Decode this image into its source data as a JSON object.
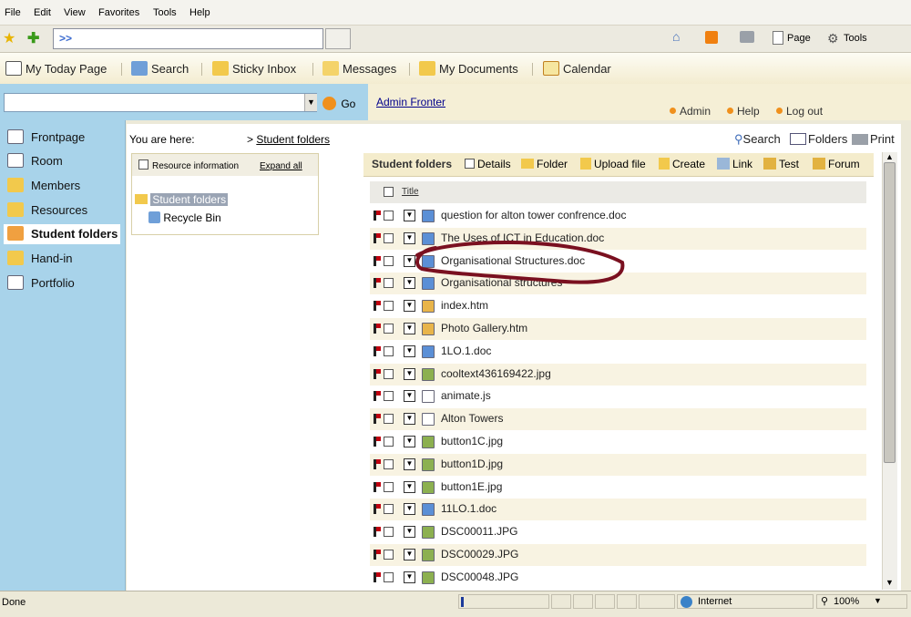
{
  "ie": {
    "menu": [
      "File",
      "Edit",
      "View",
      "Favorites",
      "Tools",
      "Help"
    ],
    "address_prefix": ">>",
    "toolbar_right": {
      "page": "Page",
      "tools": "Tools"
    }
  },
  "portal_nav": [
    "My Today Page",
    "Search",
    "Sticky Inbox",
    "Messages",
    "My Documents",
    "Calendar"
  ],
  "searchbar": {
    "go": "Go",
    "admin": "Admin Fronter",
    "links": [
      "Admin",
      "Help",
      "Log out"
    ]
  },
  "sidebar": [
    "Frontpage",
    "Room",
    "Members",
    "Resources",
    "Student folders",
    "Hand-in",
    "Portfolio"
  ],
  "breadcrumb": {
    "prefix": "You are here:",
    "sep": ">",
    "current": "Student folders"
  },
  "tools_right": {
    "search": "Search",
    "folders": "Folders",
    "print": "Print"
  },
  "tree": {
    "resource_info": "Resource information",
    "expand_all": "Expand all",
    "items": [
      "Student folders",
      "Recycle Bin"
    ]
  },
  "list": {
    "heading": "Student folders",
    "actions": [
      "Details",
      "Folder",
      "Upload file",
      "Create",
      "Link",
      "Test",
      "Forum"
    ],
    "col_title": "Title",
    "files": [
      {
        "name": "question for alton tower confrence.doc",
        "type": "doc"
      },
      {
        "name": "The Uses of ICT in Education.doc",
        "type": "doc"
      },
      {
        "name": "Organisational Structures.doc",
        "type": "doc"
      },
      {
        "name": "Organisational structures",
        "type": "doc"
      },
      {
        "name": "index.htm",
        "type": "htm"
      },
      {
        "name": "Photo Gallery.htm",
        "type": "htm"
      },
      {
        "name": "1LO.1.doc",
        "type": "doc"
      },
      {
        "name": "cooltext436169422.jpg",
        "type": "jpg"
      },
      {
        "name": "animate.js",
        "type": "js"
      },
      {
        "name": "Alton Towers",
        "type": "page"
      },
      {
        "name": "button1C.jpg",
        "type": "jpg"
      },
      {
        "name": "button1D.jpg",
        "type": "jpg"
      },
      {
        "name": "button1E.jpg",
        "type": "jpg"
      },
      {
        "name": "11LO.1.doc",
        "type": "doc"
      },
      {
        "name": "DSC00011.JPG",
        "type": "jpg"
      },
      {
        "name": "DSC00029.JPG",
        "type": "jpg"
      },
      {
        "name": "DSC00048.JPG",
        "type": "jpg"
      }
    ]
  },
  "status": {
    "left": "Done",
    "zone": "Internet",
    "zoom": "100%"
  },
  "colors": {
    "sidebar": "#a8d3ea",
    "annotation": "#7a1020",
    "accent": "#f0901c"
  }
}
